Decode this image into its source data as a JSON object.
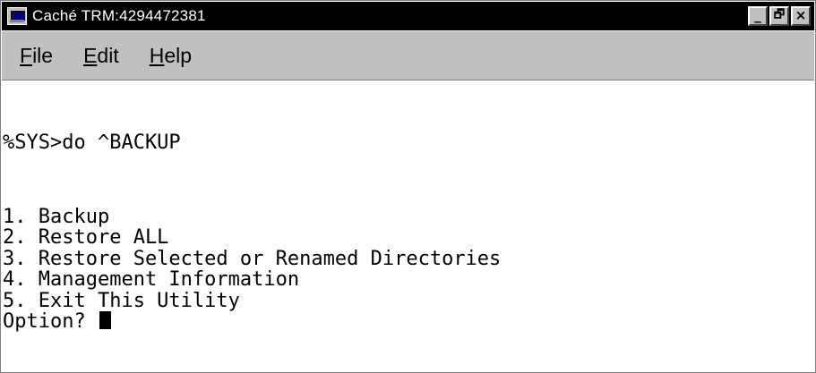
{
  "window": {
    "title": "Caché TRM:4294472381",
    "controls": {
      "minimize": "_",
      "maximize": "🗗",
      "close": "×"
    }
  },
  "menu": [
    {
      "accel": "F",
      "rest": "ile"
    },
    {
      "accel": "E",
      "rest": "dit"
    },
    {
      "accel": "H",
      "rest": "elp"
    }
  ],
  "terminal": {
    "command_line": "%SYS>do ^BACKUP",
    "options": [
      "1. Backup",
      "2. Restore ALL",
      "3. Restore Selected or Renamed Directories",
      "4. Management Information",
      "5. Exit This Utility"
    ],
    "prompt": "Option? "
  }
}
